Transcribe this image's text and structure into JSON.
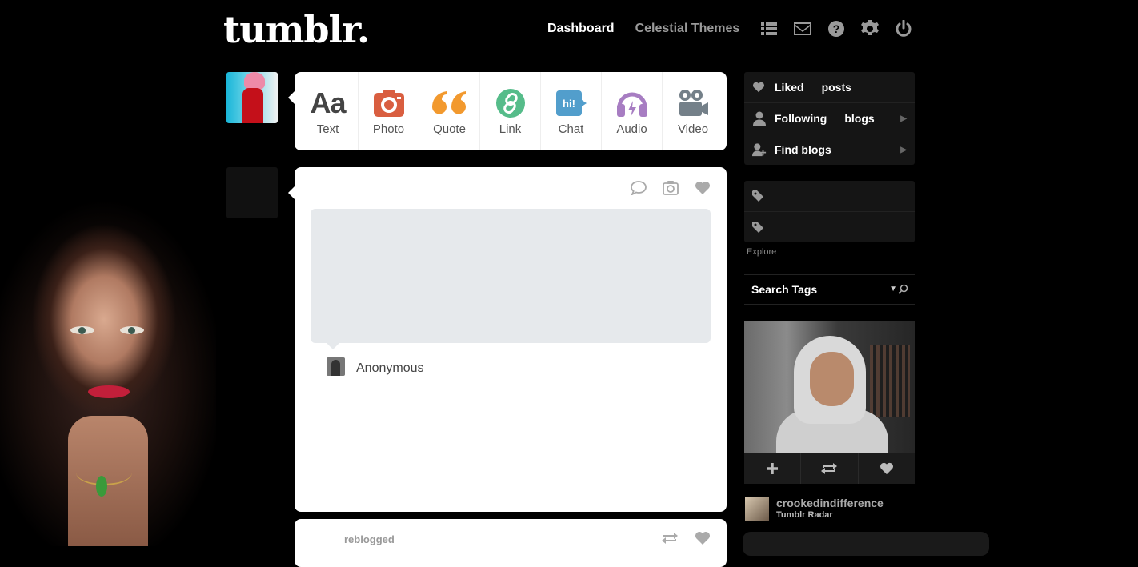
{
  "header": {
    "logo": "tumblr.",
    "nav": {
      "dashboard": "Dashboard",
      "themes": "Celestial Themes"
    },
    "icons": [
      "list-icon",
      "mail-icon",
      "help-icon",
      "gear-icon",
      "power-icon"
    ]
  },
  "post_types": [
    {
      "label": "Text",
      "glyph": "Aa",
      "color": "#444444"
    },
    {
      "label": "Photo",
      "color": "#d95e40"
    },
    {
      "label": "Quote",
      "color": "#f2992e"
    },
    {
      "label": "Link",
      "color": "#56bc8a"
    },
    {
      "label": "Chat",
      "glyph": "hi!",
      "color": "#529ecc"
    },
    {
      "label": "Audio",
      "color": "#a77dc2"
    },
    {
      "label": "Video",
      "color": "#748089"
    }
  ],
  "post": {
    "asker": "Anonymous"
  },
  "post2": {
    "status": "reblogged"
  },
  "sidebar": {
    "account": [
      {
        "label": "Liked",
        "suffix": "posts"
      },
      {
        "label": "Following",
        "suffix": "blogs"
      },
      {
        "label": "Find blogs"
      }
    ],
    "explore": "Explore",
    "search_tags": "Search Tags",
    "radar": {
      "user": "crookedindifference",
      "source": "Tumblr Radar"
    }
  }
}
